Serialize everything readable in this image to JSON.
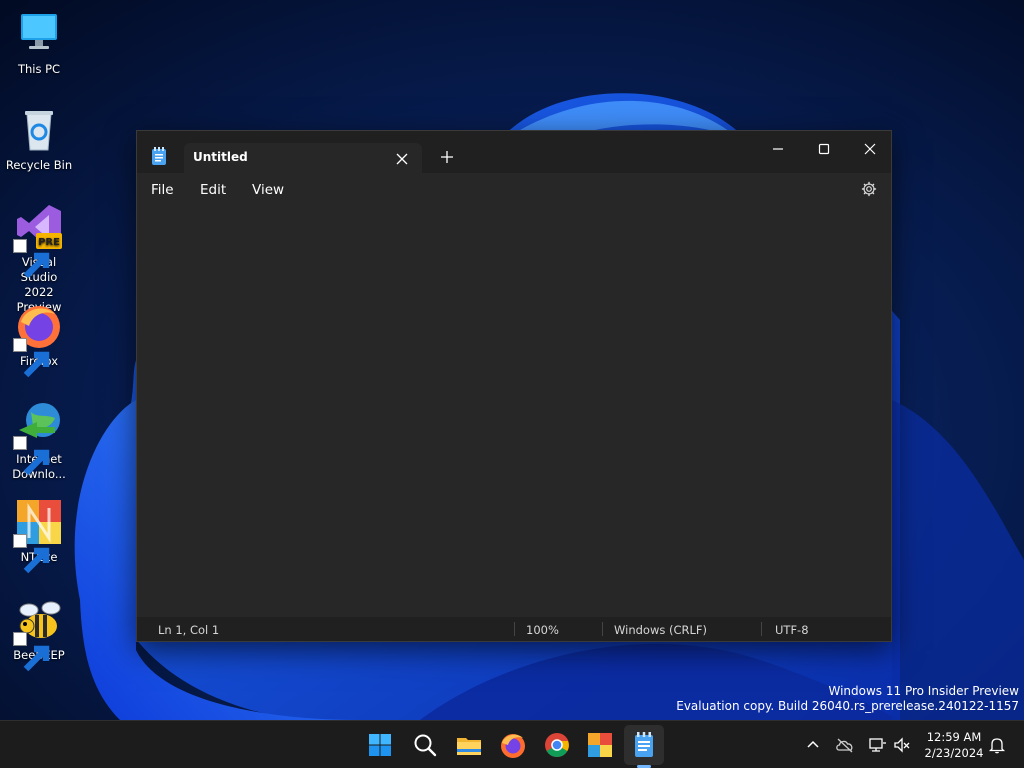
{
  "desktop": {
    "icons": [
      {
        "label_line1": "This PC",
        "label_line2": ""
      },
      {
        "label_line1": "Recycle Bin",
        "label_line2": ""
      },
      {
        "label_line1": "Visual Studio",
        "label_line2": "2022 Preview",
        "badge": "PRE"
      },
      {
        "label_line1": "Firefox",
        "label_line2": ""
      },
      {
        "label_line1": "Internet",
        "label_line2": "Downlo..."
      },
      {
        "label_line1": "NTLite",
        "label_line2": ""
      },
      {
        "label_line1": "BeeBEEP",
        "label_line2": ""
      }
    ]
  },
  "notepad": {
    "tab_title": "Untitled",
    "menu": {
      "file": "File",
      "edit": "Edit",
      "view": "View"
    },
    "editor_text": "",
    "status": {
      "position": "Ln 1, Col 1",
      "zoom": "100%",
      "line_endings": "Windows (CRLF)",
      "encoding": "UTF-8"
    }
  },
  "watermark": {
    "line1": "Windows 11 Pro Insider Preview",
    "line2": "Evaluation copy. Build 26040.rs_prerelease.240122-1157"
  },
  "taskbar": {
    "apps": [
      "start-icon",
      "search-icon",
      "file-explorer-icon",
      "firefox-icon",
      "chrome-icon",
      "ntlite-icon",
      "notepad-icon"
    ],
    "active_app": "notepad-icon",
    "time": "12:59 AM",
    "date": "2/23/2024"
  },
  "colors": {
    "window_bg": "#202020",
    "editor_bg": "#272727",
    "accent": "#75b7ff",
    "taskbar_bg": "#1c1c1c"
  }
}
